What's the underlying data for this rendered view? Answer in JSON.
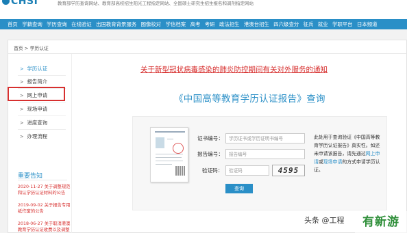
{
  "header": {
    "logo": "CHSI",
    "notice": "教育部学历查询网站、教育部高校招生阳光工程指定网站、全国硕士研究生招生报名和调剂指定网站"
  },
  "nav": {
    "items": [
      "首页",
      "学籍查询",
      "学历查询",
      "在线验证",
      "出国教育背景服务",
      "图像校对",
      "学信档案",
      "高考",
      "考研",
      "政法招生",
      "港澳台招生",
      "四六级查分",
      "征兵",
      "就业",
      "学职平台",
      "日本频道"
    ]
  },
  "breadcrumb": "首页 > 学历认证",
  "sidebar": {
    "items": [
      {
        "label": "学历认证",
        "active": true
      },
      {
        "label": "报告简介",
        "active": false
      },
      {
        "label": "网上申请",
        "active": false
      },
      {
        "label": "现场申请",
        "active": false
      },
      {
        "label": "进度查询",
        "active": false
      },
      {
        "label": "办理流程",
        "active": false
      }
    ],
    "notices_title": "重要告知",
    "notices": [
      {
        "date": "2020-11-27",
        "text": "关于调整规范和认学历认证材料的公告"
      },
      {
        "date": "2019-09-02",
        "text": "关于报告专用纸作废的公告"
      },
      {
        "date": "2018-06-27",
        "text": "关于取消港澳教育学历认证收费以及调整认证受理范围的公告"
      }
    ]
  },
  "content": {
    "covid_link": "关于新型冠状病毒感染的肺炎防控期间有关对外服务的通知",
    "report_title": "《中国高等教育学历认证报告》查询",
    "form": {
      "cert_label": "证书编号：",
      "cert_placeholder": "学历证书或学历证明书编号",
      "report_label": "报告编号：",
      "report_placeholder": "报告编号",
      "captcha_label": "验证码：",
      "captcha_placeholder": "验证码",
      "captcha_text": "4595",
      "submit_label": "查询"
    },
    "note": {
      "part1": "此处用于查询验证《中国高等教育学历认证报告》真实性。如还未申请该报告，请先通过",
      "link1": "网上申请",
      "part2": "或",
      "link2": "现场申请",
      "part3": "的方式申请学历认证。"
    }
  },
  "watermark": {
    "text": "头条 @工程",
    "badge": "有新游"
  }
}
